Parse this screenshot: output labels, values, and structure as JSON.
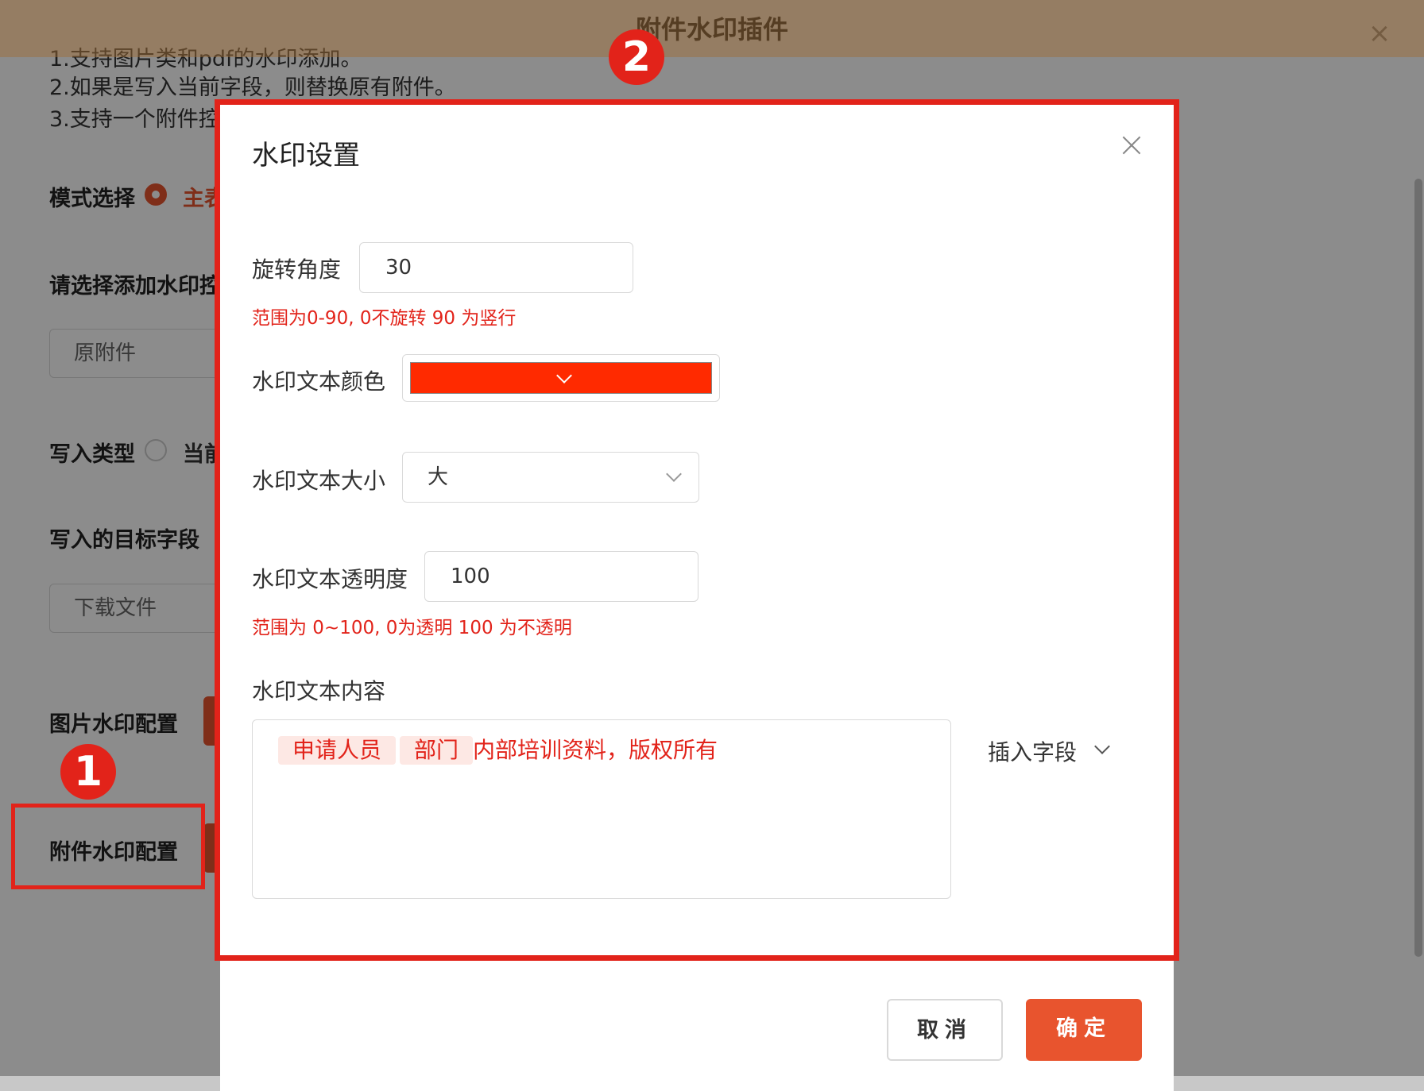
{
  "background": {
    "window_title": "附件水印插件",
    "desc_line1": "1.支持图片类和pdf的水印添加。",
    "desc_line2": "2.如果是写入当前字段，则替换原有附件。",
    "desc_line3": "3.支持一个附件控",
    "mode_label": "模式选择",
    "mode_option": "主表",
    "attach_select_label": "请选择添加水印控",
    "attach_select_value": "原附件",
    "write_type_label": "写入类型",
    "write_type_option": "当前",
    "target_field_label": "写入的目标字段",
    "target_field_value": "下载文件",
    "image_watermark_label": "图片水印配置",
    "attachment_watermark_label": "附件水印配置"
  },
  "annotations": {
    "step1": "1",
    "step2": "2"
  },
  "modal": {
    "title": "水印设置",
    "rotation": {
      "label": "旋转角度",
      "value": "30",
      "hint": "范围为0-90, 0不旋转 90 为竖行"
    },
    "color": {
      "label": "水印文本颜色",
      "value": "#ff2a00"
    },
    "size": {
      "label": "水印文本大小",
      "value": "大"
    },
    "opacity": {
      "label": "水印文本透明度",
      "value": "100",
      "hint": "范围为 0~100, 0为透明 100 为不透明"
    },
    "content": {
      "label": "水印文本内容",
      "tags": [
        "申请人员",
        "部门"
      ],
      "text": "内部培训资料，版权所有",
      "insert_field_label": "插入字段"
    },
    "cancel_label": "取消",
    "ok_label": "确定"
  },
  "colors": {
    "accent": "#e8542e",
    "annotation": "#e2231a"
  }
}
